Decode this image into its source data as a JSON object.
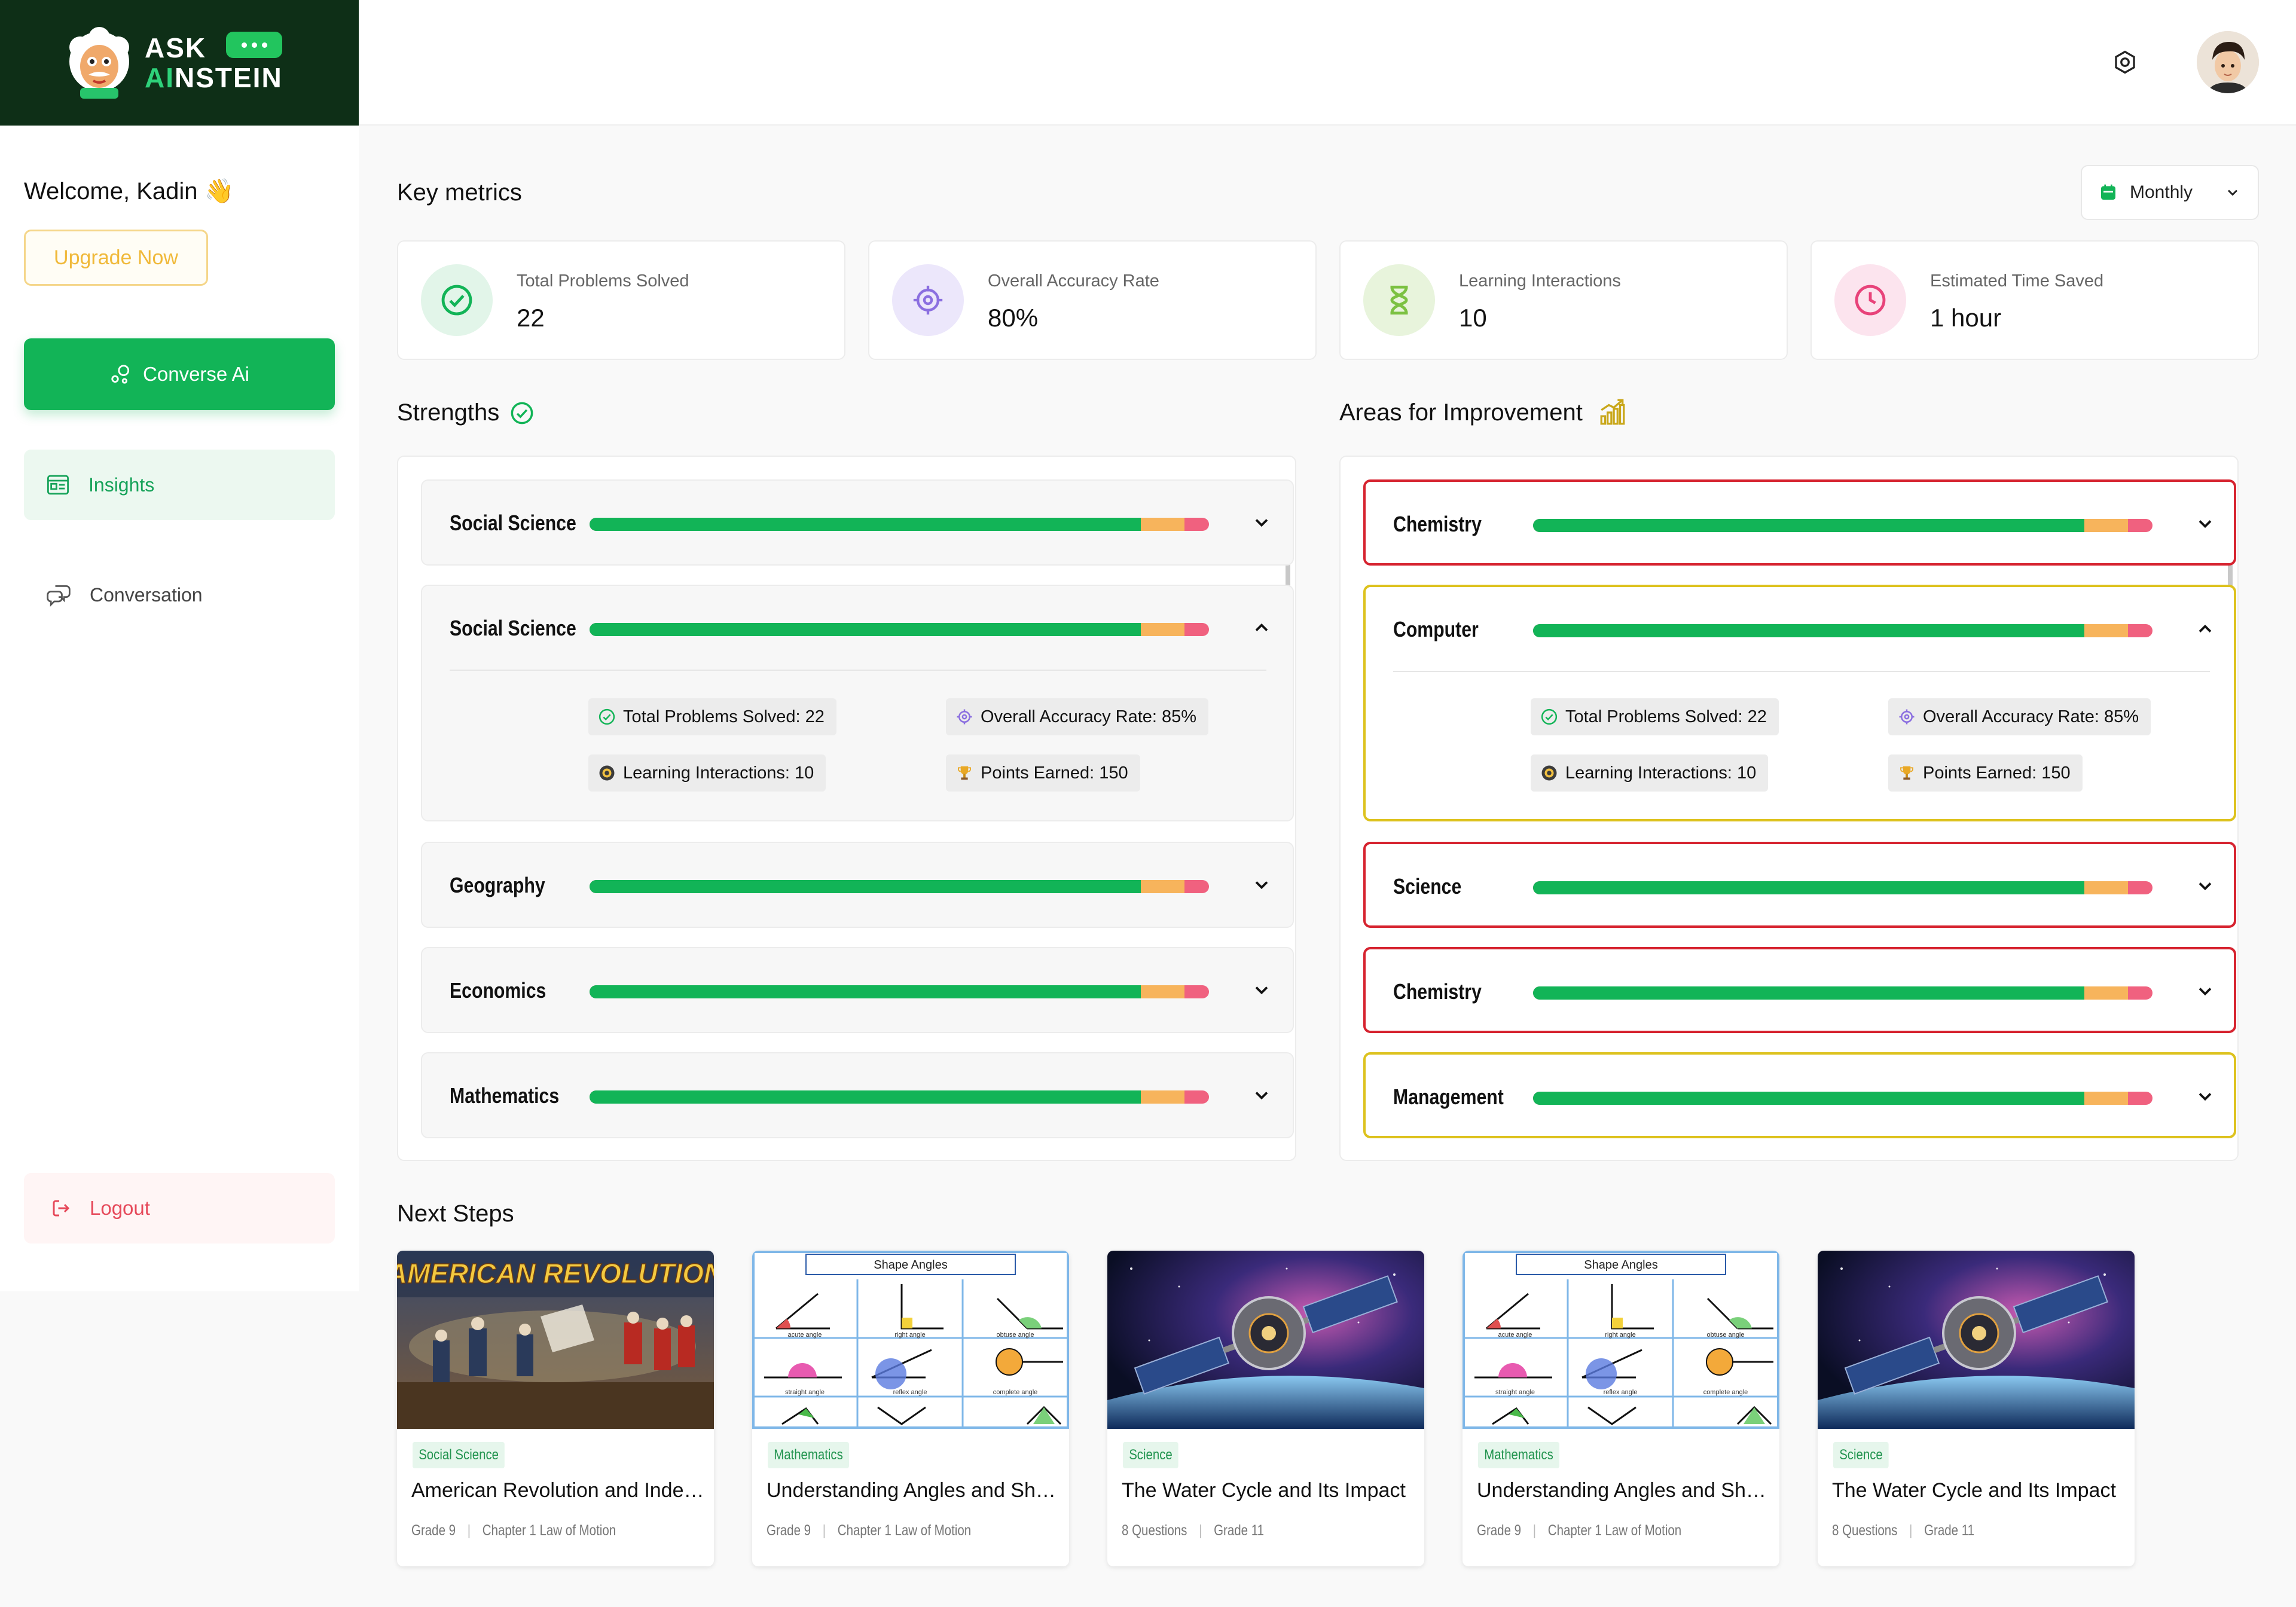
{
  "brand": {
    "line1": "ASK",
    "line2a": "AI",
    "line2b": "NSTEIN"
  },
  "sidebar": {
    "welcome": "Welcome, Kadin 👋",
    "upgrade": "Upgrade Now",
    "converse": "Converse Ai",
    "nav": [
      {
        "label": "Insights",
        "active": true
      },
      {
        "label": "Conversation",
        "active": false
      }
    ],
    "logout": "Logout"
  },
  "header": {
    "icons": [
      "gear-icon",
      "avatar"
    ]
  },
  "key_metrics": {
    "title": "Key metrics",
    "period": "Monthly",
    "items": [
      {
        "label": "Total Problems Solved",
        "value": "22",
        "icon": "check-circle-icon",
        "color": "#12b457"
      },
      {
        "label": "Overall Accuracy Rate",
        "value": "80%",
        "icon": "crosshair-icon",
        "color": "#8b6fe0"
      },
      {
        "label": "Learning Interactions",
        "value": "10",
        "icon": "hourglass-icon",
        "color": "#7cc142"
      },
      {
        "label": "Estimated Time Saved",
        "value": "1 hour",
        "icon": "clock-icon",
        "color": "#e8437a"
      }
    ]
  },
  "strengths": {
    "title": "Strengths",
    "items": [
      {
        "name": "Social Science",
        "expanded": false
      },
      {
        "name": "Social Science",
        "expanded": true,
        "stats": [
          "Total Problems Solved: 22",
          "Overall Accuracy Rate: 85%",
          "Learning Interactions: 10",
          "Points Earned: 150"
        ]
      },
      {
        "name": "Geography",
        "expanded": false
      },
      {
        "name": "Economics",
        "expanded": false
      },
      {
        "name": "Mathematics",
        "expanded": false
      }
    ]
  },
  "improvement": {
    "title": "Areas for Improvement",
    "items": [
      {
        "name": "Chemistry",
        "expanded": false,
        "border": "#d6232f"
      },
      {
        "name": "Computer",
        "expanded": true,
        "border": "#ddc21e",
        "stats": [
          "Total Problems Solved: 22",
          "Overall Accuracy Rate: 85%",
          "Learning Interactions: 10",
          "Points Earned: 150"
        ]
      },
      {
        "name": "Science",
        "expanded": false,
        "border": "#d6232f"
      },
      {
        "name": "Chemistry",
        "expanded": false,
        "border": "#d6232f"
      },
      {
        "name": "Management",
        "expanded": false,
        "border": "#ddc21e"
      }
    ]
  },
  "progress_split": {
    "green": 0.89,
    "orange": 0.07,
    "pink": 0.04
  },
  "next_steps": {
    "title": "Next Steps",
    "cards": [
      {
        "image": "american-revolution",
        "image_text": "AMERICAN REVOLUTION",
        "tag": "Social Science",
        "title": "American Revolution and Indep...",
        "meta": [
          "Grade 9",
          "Chapter 1 Law of Motion"
        ]
      },
      {
        "image": "shape-angles",
        "image_text": "Shape Angles",
        "tag": "Mathematics",
        "title": "Understanding Angles and Shapes",
        "meta": [
          "Grade 9",
          "Chapter 1 Law of Motion"
        ]
      },
      {
        "image": "satellite-space",
        "tag": "Science",
        "title": "The Water Cycle and Its Impact",
        "meta": [
          "8 Questions",
          "Grade 11"
        ]
      },
      {
        "image": "shape-angles",
        "image_text": "Shape Angles",
        "tag": "Mathematics",
        "title": "Understanding Angles and Shapes",
        "meta": [
          "Grade 9",
          "Chapter 1 Law of Motion"
        ]
      },
      {
        "image": "satellite-space",
        "tag": "Science",
        "title": "The Water Cycle and Its Impact",
        "meta": [
          "8 Questions",
          "Grade 11"
        ]
      }
    ],
    "angle_labels": [
      "acute angle",
      "right angle",
      "obtuse angle",
      "straight angle",
      "reflex angle",
      "complete angle"
    ]
  }
}
